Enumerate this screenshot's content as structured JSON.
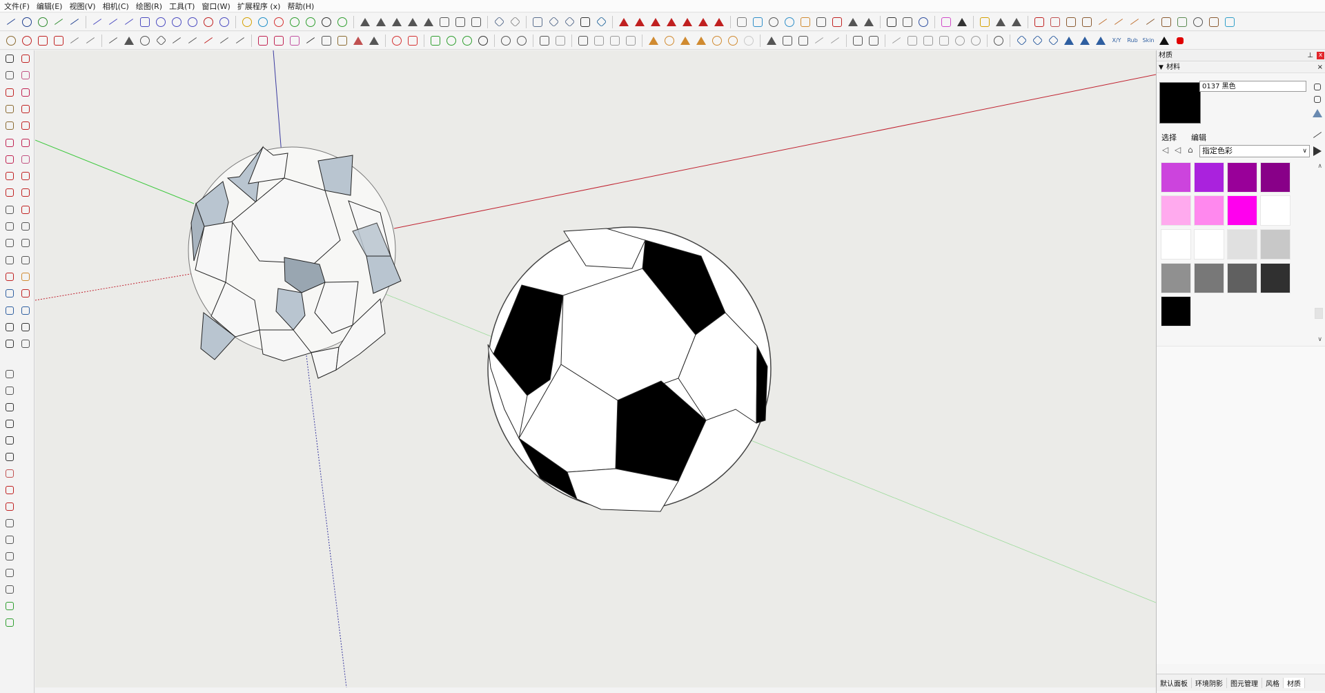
{
  "menu": [
    "文件(F)",
    "编辑(E)",
    "视图(V)",
    "相机(C)",
    "绘图(R)",
    "工具(T)",
    "窗口(W)",
    "扩展程序 (x)",
    "帮助(H)"
  ],
  "toolbar_row1": [
    {
      "icon": "arc-icon",
      "shape": "l",
      "color": "#1f3f8f"
    },
    {
      "icon": "circle-icon",
      "shape": "c",
      "color": "#1f3f8f"
    },
    {
      "icon": "spiral-icon",
      "shape": "c",
      "color": "#2e8b2e"
    },
    {
      "icon": "freehand-icon",
      "shape": "l",
      "color": "#2e8b2e"
    },
    {
      "icon": "curve-icon",
      "shape": "l",
      "color": "#1f3f8f"
    },
    {
      "icon": "sep"
    },
    {
      "icon": "polyline-icon",
      "shape": "l",
      "color": "#4a4ac0"
    },
    {
      "icon": "bezier-icon",
      "shape": "l",
      "color": "#4a4ac0"
    },
    {
      "icon": "wave-icon",
      "shape": "l",
      "color": "#4a4ac0"
    },
    {
      "icon": "rectangle-icon",
      "shape": "s",
      "color": "#4a4ac0"
    },
    {
      "icon": "ellipse-icon",
      "shape": "c",
      "color": "#4a4ac0"
    },
    {
      "icon": "hook-icon",
      "shape": "c",
      "color": "#4a4ac0"
    },
    {
      "icon": "arc2-icon",
      "shape": "c",
      "color": "#4a4ac0"
    },
    {
      "icon": "arc3-icon",
      "shape": "c",
      "color": "#c02020"
    },
    {
      "icon": "arc4-icon",
      "shape": "c",
      "color": "#4a4ac0"
    },
    {
      "icon": "sep"
    },
    {
      "icon": "coil-icon",
      "shape": "c",
      "color": "#d4a000"
    },
    {
      "icon": "loop-icon",
      "shape": "c",
      "color": "#1e8fc8"
    },
    {
      "icon": "flower-icon",
      "shape": "c",
      "color": "#d43030"
    },
    {
      "icon": "knot-icon",
      "shape": "c",
      "color": "#2e9e2e"
    },
    {
      "icon": "curl-icon",
      "shape": "c",
      "color": "#2e9e2e"
    },
    {
      "icon": "gear-icon",
      "shape": "c",
      "color": "#333333"
    },
    {
      "icon": "target-icon",
      "shape": "c",
      "color": "#2e9e2e"
    },
    {
      "icon": "sep"
    },
    {
      "icon": "fan-icon",
      "shape": "t",
      "color": "#555555"
    },
    {
      "icon": "shell-icon",
      "shape": "t",
      "color": "#555555"
    },
    {
      "icon": "shell2-icon",
      "shape": "t",
      "color": "#555555"
    },
    {
      "icon": "shell3-icon",
      "shape": "t",
      "color": "#555555"
    },
    {
      "icon": "plant-icon",
      "shape": "t",
      "color": "#555555"
    },
    {
      "icon": "box-icon",
      "shape": "s",
      "color": "#555555"
    },
    {
      "icon": "tube-icon",
      "shape": "s",
      "color": "#555555"
    },
    {
      "icon": "net-icon",
      "shape": "s",
      "color": "#555555"
    },
    {
      "icon": "sep"
    },
    {
      "icon": "plane-icon",
      "shape": "d",
      "color": "#5a6e8e"
    },
    {
      "icon": "plane2-icon",
      "shape": "d",
      "color": "#8a8a8a"
    },
    {
      "icon": "sep"
    },
    {
      "icon": "page-icon",
      "shape": "s",
      "color": "#5a6e8e"
    },
    {
      "icon": "page2-icon",
      "shape": "d",
      "color": "#5a6e8e"
    },
    {
      "icon": "page3-icon",
      "shape": "d",
      "color": "#5a6e8e"
    },
    {
      "icon": "stack-icon",
      "shape": "s",
      "color": "#333333"
    },
    {
      "icon": "tile-icon",
      "shape": "d",
      "color": "#2e6ea0"
    },
    {
      "icon": "sep"
    },
    {
      "icon": "axis-icon",
      "shape": "t",
      "color": "#c02020"
    },
    {
      "icon": "axis2-icon",
      "shape": "t",
      "color": "#c02020"
    },
    {
      "icon": "axis3-icon",
      "shape": "t",
      "color": "#c02020"
    },
    {
      "icon": "axis4-icon",
      "shape": "t",
      "color": "#c02020"
    },
    {
      "icon": "axis5-icon",
      "shape": "t",
      "color": "#c02020"
    },
    {
      "icon": "axis6-icon",
      "shape": "t",
      "color": "#c02020"
    },
    {
      "icon": "axis7-icon",
      "shape": "t",
      "color": "#c02020"
    },
    {
      "icon": "sep"
    },
    {
      "icon": "tool-icon",
      "shape": "s",
      "color": "#7a7a7a"
    },
    {
      "icon": "cube-icon",
      "shape": "s",
      "color": "#2e8ec8"
    },
    {
      "icon": "globe-icon",
      "shape": "c",
      "color": "#555555"
    },
    {
      "icon": "ball-icon",
      "shape": "c",
      "color": "#2e8ec8"
    },
    {
      "icon": "hand-icon",
      "shape": "s",
      "color": "#d08a30"
    },
    {
      "icon": "hammer-icon",
      "shape": "s",
      "color": "#555555"
    },
    {
      "icon": "boxes-icon",
      "shape": "s",
      "color": "#c02020"
    },
    {
      "icon": "roof-icon",
      "shape": "t",
      "color": "#555555"
    },
    {
      "icon": "house-icon",
      "shape": "t",
      "color": "#555555"
    },
    {
      "icon": "sep"
    },
    {
      "icon": "layers-icon",
      "shape": "s",
      "color": "#333333"
    },
    {
      "icon": "grid-icon",
      "shape": "s",
      "color": "#555555"
    },
    {
      "icon": "sphere-icon",
      "shape": "c",
      "color": "#2e4ea0"
    },
    {
      "icon": "sep"
    },
    {
      "icon": "palette-icon",
      "shape": "s",
      "color": "#d04ac8"
    },
    {
      "icon": "cursor-icon",
      "shape": "t",
      "color": "#333333"
    },
    {
      "icon": "sep"
    },
    {
      "icon": "bridge-icon",
      "shape": "s",
      "color": "#d4a000"
    },
    {
      "icon": "tripod-icon",
      "shape": "t",
      "color": "#555555"
    },
    {
      "icon": "chair-icon",
      "shape": "t",
      "color": "#555555"
    },
    {
      "icon": "sep"
    },
    {
      "icon": "bed-icon",
      "shape": "s",
      "color": "#c02020"
    },
    {
      "icon": "sofa-icon",
      "shape": "s",
      "color": "#c05050"
    },
    {
      "icon": "crate-icon",
      "shape": "s",
      "color": "#8a5a30"
    },
    {
      "icon": "crate2-icon",
      "shape": "s",
      "color": "#8a5a30"
    },
    {
      "icon": "pencil-icon",
      "shape": "l",
      "color": "#c07030"
    },
    {
      "icon": "brush-icon",
      "shape": "l",
      "color": "#c07030"
    },
    {
      "icon": "brush2-icon",
      "shape": "l",
      "color": "#c07030"
    },
    {
      "icon": "ruler-icon",
      "shape": "l",
      "color": "#8a5a30"
    },
    {
      "icon": "block-icon",
      "shape": "s",
      "color": "#8a5a30"
    },
    {
      "icon": "barrel-icon",
      "shape": "s",
      "color": "#5a8a50"
    },
    {
      "icon": "refresh-icon",
      "shape": "c",
      "color": "#555555"
    },
    {
      "icon": "trowel-icon",
      "shape": "s",
      "color": "#8a5a30"
    },
    {
      "icon": "paint-icon",
      "shape": "s",
      "color": "#2e9ec8"
    }
  ],
  "toolbar_row2": [
    {
      "icon": "gear2-icon",
      "shape": "c",
      "color": "#8a6a30"
    },
    {
      "icon": "flower2-icon",
      "shape": "c",
      "color": "#c02020"
    },
    {
      "icon": "frame-icon",
      "shape": "s",
      "color": "#c02020"
    },
    {
      "icon": "book-icon",
      "shape": "s",
      "color": "#c02020"
    },
    {
      "icon": "wand-icon",
      "shape": "l",
      "color": "#7a7a7a"
    },
    {
      "icon": "wand2-icon",
      "shape": "l",
      "color": "#7a7a7a"
    },
    {
      "icon": "sep"
    },
    {
      "icon": "paintbrush-icon",
      "shape": "l",
      "color": "#555555"
    },
    {
      "icon": "bucket-icon",
      "shape": "t",
      "color": "#555555"
    },
    {
      "icon": "circle2-icon",
      "shape": "c",
      "color": "#555555"
    },
    {
      "icon": "diamond-icon",
      "shape": "d",
      "color": "#555555"
    },
    {
      "icon": "scissors-icon",
      "shape": "l",
      "color": "#555555"
    },
    {
      "icon": "snip-icon",
      "shape": "l",
      "color": "#555555"
    },
    {
      "icon": "path-icon",
      "shape": "l",
      "color": "#c02020"
    },
    {
      "icon": "path2-icon",
      "shape": "l",
      "color": "#555555"
    },
    {
      "icon": "path3-icon",
      "shape": "l",
      "color": "#555555"
    },
    {
      "icon": "sep"
    },
    {
      "icon": "panel-icon",
      "shape": "s",
      "color": "#c02050"
    },
    {
      "icon": "sofa2-icon",
      "shape": "s",
      "color": "#c02050"
    },
    {
      "icon": "crate3-icon",
      "shape": "s",
      "color": "#c050a0"
    },
    {
      "icon": "arch-icon",
      "shape": "l",
      "color": "#333333"
    },
    {
      "icon": "sled-icon",
      "shape": "s",
      "color": "#555555"
    },
    {
      "icon": "bench-icon",
      "shape": "s",
      "color": "#8a6a30"
    },
    {
      "icon": "sail-icon",
      "shape": "t",
      "color": "#c05050"
    },
    {
      "icon": "hatch-icon",
      "shape": "t",
      "color": "#555555"
    },
    {
      "icon": "sep"
    },
    {
      "icon": "sun-icon",
      "shape": "c",
      "color": "#d43030"
    },
    {
      "icon": "tiles-icon",
      "shape": "s",
      "color": "#d43030"
    },
    {
      "icon": "sep"
    },
    {
      "icon": "export-icon",
      "shape": "s",
      "color": "#2e9e2e"
    },
    {
      "icon": "tree-icon",
      "shape": "c",
      "color": "#2e9e2e"
    },
    {
      "icon": "trees-icon",
      "shape": "c",
      "color": "#2e9e2e"
    },
    {
      "icon": "check-icon",
      "shape": "c",
      "color": "#333333"
    },
    {
      "icon": "sep"
    },
    {
      "icon": "teapot-icon",
      "shape": "c",
      "color": "#555555"
    },
    {
      "icon": "teapot2-icon",
      "shape": "c",
      "color": "#555555"
    },
    {
      "icon": "sep"
    },
    {
      "icon": "render-icon",
      "shape": "s",
      "color": "#555555"
    },
    {
      "icon": "render2-icon",
      "shape": "s",
      "color": "#9a9a9a"
    },
    {
      "icon": "sep"
    },
    {
      "icon": "window-icon",
      "shape": "s",
      "color": "#555555"
    },
    {
      "icon": "window2-icon",
      "shape": "s",
      "color": "#9a9a9a"
    },
    {
      "icon": "window3-icon",
      "shape": "s",
      "color": "#9a9a9a"
    },
    {
      "icon": "lock-icon",
      "shape": "s",
      "color": "#9a9a9a"
    },
    {
      "icon": "sep"
    },
    {
      "icon": "lamp-icon",
      "shape": "t",
      "color": "#d08a30"
    },
    {
      "icon": "ring-icon",
      "shape": "c",
      "color": "#d08a30"
    },
    {
      "icon": "triangle-icon",
      "shape": "t",
      "color": "#d08a30"
    },
    {
      "icon": "stand-icon",
      "shape": "t",
      "color": "#d08a30"
    },
    {
      "icon": "star-icon",
      "shape": "c",
      "color": "#d08a30"
    },
    {
      "icon": "dome-icon",
      "shape": "c",
      "color": "#d08a30"
    },
    {
      "icon": "dim-icon",
      "shape": "c",
      "color": "#c8c8c8"
    },
    {
      "icon": "sep"
    },
    {
      "icon": "stool-icon",
      "shape": "t",
      "color": "#555555"
    },
    {
      "icon": "cube2-icon",
      "shape": "s",
      "color": "#555555"
    },
    {
      "icon": "cube3-icon",
      "shape": "s",
      "color": "#555555"
    },
    {
      "icon": "leaf-icon",
      "shape": "l",
      "color": "#9a9a9a"
    },
    {
      "icon": "leaf2-icon",
      "shape": "l",
      "color": "#9a9a9a"
    },
    {
      "icon": "sep"
    },
    {
      "icon": "group-icon",
      "shape": "s",
      "color": "#555555"
    },
    {
      "icon": "group2-icon",
      "shape": "s",
      "color": "#555555"
    },
    {
      "icon": "sep"
    },
    {
      "icon": "edge-icon",
      "shape": "l",
      "color": "#9a9a9a"
    },
    {
      "icon": "iso-icon",
      "shape": "s",
      "color": "#9a9a9a"
    },
    {
      "icon": "iso2-icon",
      "shape": "s",
      "color": "#9a9a9a"
    },
    {
      "icon": "iso3-icon",
      "shape": "s",
      "color": "#9a9a9a"
    },
    {
      "icon": "sphere2-icon",
      "shape": "c",
      "color": "#9a9a9a"
    },
    {
      "icon": "sphere3-icon",
      "shape": "c",
      "color": "#9a9a9a"
    },
    {
      "icon": "sep"
    },
    {
      "icon": "search-icon",
      "shape": "c",
      "color": "#555555"
    },
    {
      "icon": "sep"
    },
    {
      "icon": "shape1-icon",
      "shape": "d",
      "color": "#2e5ea0"
    },
    {
      "icon": "shape2-icon",
      "shape": "d",
      "color": "#2e5ea0"
    },
    {
      "icon": "shape3-icon",
      "shape": "d",
      "color": "#2e5ea0"
    },
    {
      "icon": "shape4-icon",
      "shape": "t",
      "color": "#2e5ea0"
    },
    {
      "icon": "shape5-icon",
      "shape": "t",
      "color": "#2e5ea0"
    },
    {
      "icon": "shape6-icon",
      "shape": "t",
      "color": "#2e5ea0"
    },
    {
      "icon": "xy-icon",
      "shape": "s",
      "color": "#2e5ea0"
    },
    {
      "icon": "rub-icon",
      "shape": "s",
      "color": "#2e5ea0"
    },
    {
      "icon": "skin-icon",
      "shape": "s",
      "color": "#2e5ea0"
    },
    {
      "icon": "play-icon",
      "shape": "t",
      "color": "#111111"
    },
    {
      "icon": "stop-icon",
      "shape": "s",
      "color": "#e00000"
    }
  ],
  "toolbar_text_icons": {
    "xy": "X/Y",
    "rub": "Rub",
    "skin": "Skin"
  },
  "left_tools": [
    "select-icon",
    "eraser-icon",
    "paint-bucket-icon",
    "eraser2-icon",
    "line-icon",
    "freehand-draw-icon",
    "rectangle-tool-icon",
    "rotated-rect-icon",
    "circle-tool-icon",
    "polygon-icon",
    "arc-tool-icon",
    "arc-tool2-icon",
    "arc-tool3-icon",
    "pie-icon",
    "move-icon",
    "push-pull-icon",
    "rotate-icon",
    "follow-me-icon",
    "scale-icon",
    "offset-icon",
    "tape-measure-icon",
    "dimension-icon",
    "protractor-icon",
    "text-icon",
    "axes-icon",
    "3d-text-icon",
    "orbit-icon",
    "pan-icon",
    "zoom-icon",
    "zoom-window-icon",
    "zoom-extents-icon",
    "previous-view-icon",
    "position-camera-icon",
    "look-around-icon",
    "walk-icon",
    "section-plane-icon",
    "sandbox-icon",
    "sandbox2-icon",
    "warehouse-icon",
    "warehouse2-icon",
    "house-outline-icon",
    "building-icon",
    "terrain-icon",
    "terrain2-icon",
    "stamp-icon",
    "drape-icon",
    "smoove-icon",
    "flip-edge-icon",
    "add-detail-icon",
    "contours-icon",
    "layer-icon",
    "map-icon"
  ],
  "panel": {
    "title": "材质",
    "pin": "⊥",
    "close": "x",
    "section": "材料",
    "section_close": "×",
    "material_name": "0137 黑色",
    "tab_select": "选择",
    "tab_edit": "编辑",
    "collection": "指定色彩",
    "swatches": [
      [
        "#cc44dd",
        "#aa22dd",
        "#990099",
        "#880088"
      ],
      [
        "#ffaaee",
        "#ff88ee",
        "#ff00ee",
        "#ffffff"
      ],
      [
        "#ffffff",
        "#ffffff",
        "#e0e0e0",
        "#c8c8c8"
      ],
      [
        "#909090",
        "#787878",
        "#606060",
        "#303030"
      ],
      [
        "#000000"
      ]
    ],
    "tray_tabs": [
      "默认面板",
      "环境阴影",
      "图元管理",
      "风格",
      "材质"
    ]
  },
  "colors": {
    "red_axis": "#c0202e",
    "green_axis": "#3cc83c",
    "blue_axis": "#3a3aa0",
    "viewport_bg": "#ebebe8",
    "ball_black": "#000000"
  }
}
